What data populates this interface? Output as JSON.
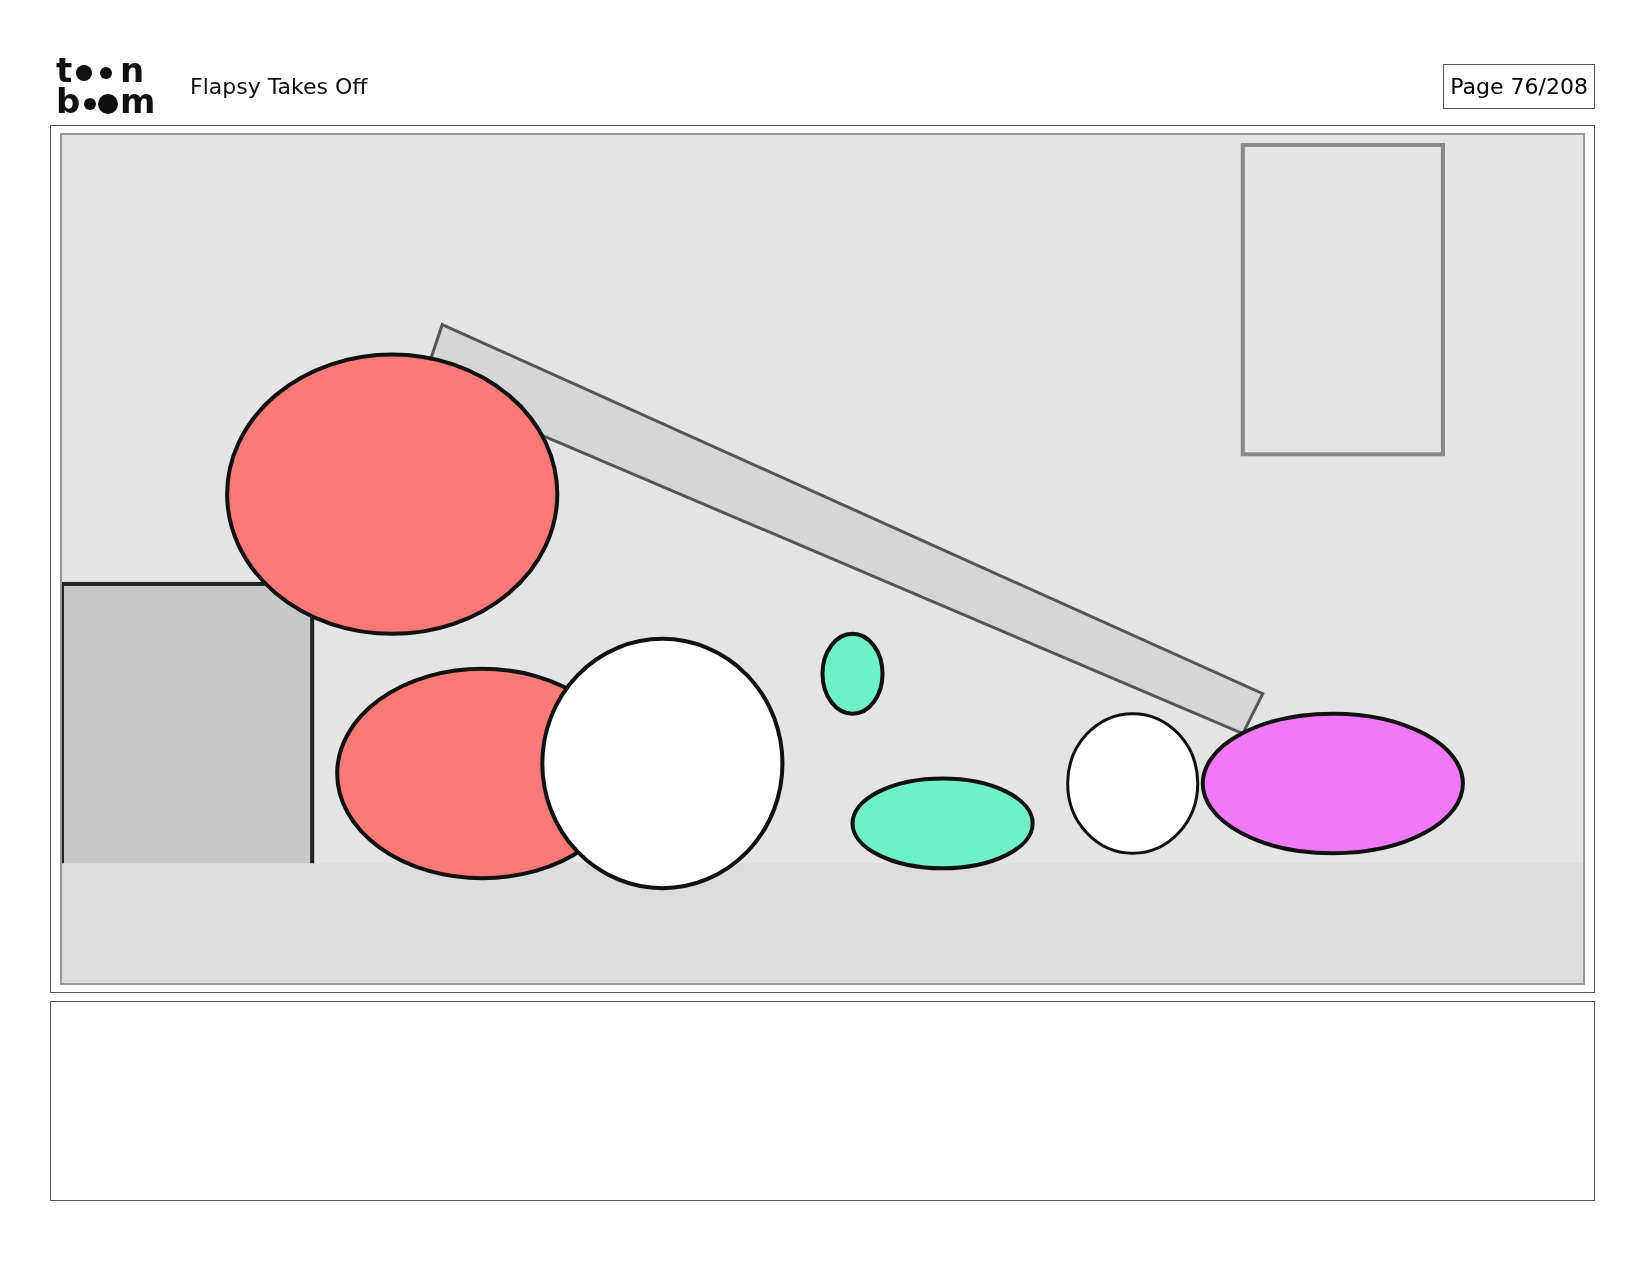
{
  "logo": {
    "rows": [
      {
        "start": "t",
        "end": "n"
      },
      {
        "start": "b",
        "end": "m"
      }
    ]
  },
  "title": "Flapsy Takes Off",
  "page": "Page  76/208"
}
